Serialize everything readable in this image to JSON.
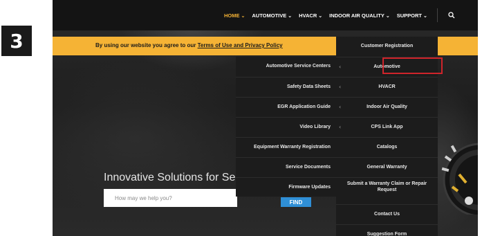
{
  "step": "3",
  "nav": {
    "items": [
      {
        "label": "HOME",
        "active": true
      },
      {
        "label": "AUTOMOTIVE",
        "active": false
      },
      {
        "label": "HVACR",
        "active": false
      },
      {
        "label": "INDOOR AIR QUALITY",
        "active": false
      },
      {
        "label": "SUPPORT",
        "active": false
      }
    ],
    "chevron": "⌄",
    "search_icon": "search-icon"
  },
  "consent": {
    "text": "By using our website you agree to our ",
    "link": "Terms of Use and Privacy Policy"
  },
  "support_menu_left": [
    "Automotive Service Centers",
    "Safety Data Sheets",
    "EGR Application Guide",
    "Video Library",
    "Equipment Warranty Registration",
    "Service Documents",
    "Firmware Updates"
  ],
  "support_menu_right": [
    "Customer Registration",
    "Automotive",
    "HVACR",
    "Indoor Air Quality",
    "CPS Link App",
    "Catalogs",
    "General Warranty",
    "Submit a Warranty Claim or Repair Request",
    "Contact Us",
    "Suggestion Form"
  ],
  "submenu_arrow": "‹",
  "hero": {
    "title": "Innovative Solutions for Serv",
    "search_placeholder": "How may we help you?",
    "find_label": "FIND"
  },
  "colors": {
    "accent": "#f5b335",
    "highlight": "#d0242b",
    "nav_bg": "#141414",
    "menu_bg": "#1c1c1c",
    "find": "#2f8fd6"
  }
}
